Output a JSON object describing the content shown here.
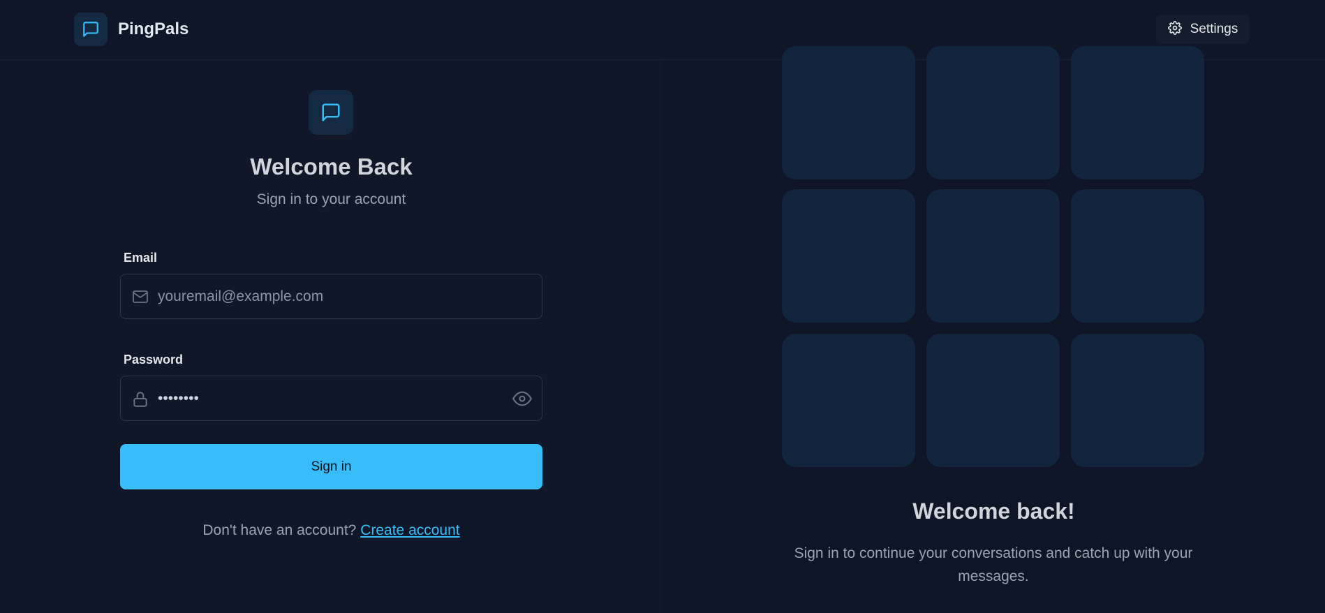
{
  "navbar": {
    "brand_name": "PingPals",
    "settings_label": "Settings"
  },
  "login": {
    "title": "Welcome Back",
    "subtitle": "Sign in to your account",
    "email_label": "Email",
    "email_placeholder": "youremail@example.com",
    "password_label": "Password",
    "password_value": "••••••••",
    "submit_label": "Sign in",
    "signup_prompt": "Don't have an account?",
    "signup_link": "Create account"
  },
  "promo": {
    "title": "Welcome back!",
    "text": "Sign in to continue your conversations and catch up with your messages.",
    "tile_count": 9
  },
  "icons": {
    "brand": "message-square-icon",
    "settings": "gear-icon",
    "email": "mail-icon",
    "password": "lock-icon",
    "toggle": "eye-icon"
  },
  "colors": {
    "accent": "#38bdf8",
    "background": "#0f1729",
    "tile": "#11253c"
  }
}
